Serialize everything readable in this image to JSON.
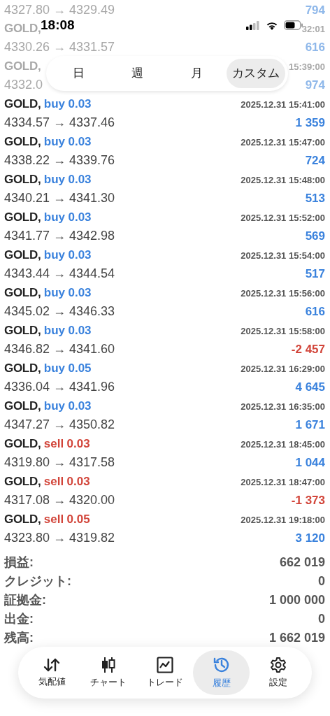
{
  "status_bar": {
    "time": "18:08"
  },
  "period_tabs": [
    {
      "label": "日",
      "selected": false
    },
    {
      "label": "週",
      "selected": false
    },
    {
      "label": "月",
      "selected": false
    },
    {
      "label": "カスタム",
      "selected": true
    }
  ],
  "partial_rows": [
    {
      "prices": "4327.80 → 4329.49",
      "amount": "794"
    },
    {
      "symbol": "GOLD,",
      "time": "32:01",
      "prices": "4330.26 → 4331.57",
      "amount": "616"
    },
    {
      "symbol": "GOLD,",
      "time": "15:39:00",
      "prices": "4332.0",
      "amount": "974"
    }
  ],
  "trades": [
    {
      "symbol": "GOLD,",
      "side": "buy",
      "volume": "0.03",
      "time": "2025.12.31 15:41:00",
      "prices": "4334.57 → 4337.46",
      "profit": "1 359"
    },
    {
      "symbol": "GOLD,",
      "side": "buy",
      "volume": "0.03",
      "time": "2025.12.31 15:47:00",
      "prices": "4338.22 → 4339.76",
      "profit": "724"
    },
    {
      "symbol": "GOLD,",
      "side": "buy",
      "volume": "0.03",
      "time": "2025.12.31 15:48:00",
      "prices": "4340.21 → 4341.30",
      "profit": "513"
    },
    {
      "symbol": "GOLD,",
      "side": "buy",
      "volume": "0.03",
      "time": "2025.12.31 15:52:00",
      "prices": "4341.77 → 4342.98",
      "profit": "569"
    },
    {
      "symbol": "GOLD,",
      "side": "buy",
      "volume": "0.03",
      "time": "2025.12.31 15:54:00",
      "prices": "4343.44 → 4344.54",
      "profit": "517"
    },
    {
      "symbol": "GOLD,",
      "side": "buy",
      "volume": "0.03",
      "time": "2025.12.31 15:56:00",
      "prices": "4345.02 → 4346.33",
      "profit": "616"
    },
    {
      "symbol": "GOLD,",
      "side": "buy",
      "volume": "0.03",
      "time": "2025.12.31 15:58:00",
      "prices": "4346.82 → 4341.60",
      "profit": "-2 457"
    },
    {
      "symbol": "GOLD,",
      "side": "buy",
      "volume": "0.05",
      "time": "2025.12.31 16:29:00",
      "prices": "4336.04 → 4341.96",
      "profit": "4 645"
    },
    {
      "symbol": "GOLD,",
      "side": "buy",
      "volume": "0.03",
      "time": "2025.12.31 16:35:00",
      "prices": "4347.27 → 4350.82",
      "profit": "1 671"
    },
    {
      "symbol": "GOLD,",
      "side": "sell",
      "volume": "0.03",
      "time": "2025.12.31 18:45:00",
      "prices": "4319.80 → 4317.58",
      "profit": "1 044"
    },
    {
      "symbol": "GOLD,",
      "side": "sell",
      "volume": "0.03",
      "time": "2025.12.31 18:47:00",
      "prices": "4317.08 → 4320.00",
      "profit": "-1 373"
    },
    {
      "symbol": "GOLD,",
      "side": "sell",
      "volume": "0.05",
      "time": "2025.12.31 19:18:00",
      "prices": "4323.80 → 4319.82",
      "profit": "3 120"
    }
  ],
  "summary": [
    {
      "label": "損益:",
      "value": "662 019"
    },
    {
      "label": "クレジット:",
      "value": "0"
    },
    {
      "label": "証拠金:",
      "value": "1 000 000"
    },
    {
      "label": "出金:",
      "value": "0"
    },
    {
      "label": "残高:",
      "value": "1 662 019"
    }
  ],
  "nav": [
    {
      "kind": "quotes",
      "label": "気配値",
      "selected": false
    },
    {
      "kind": "chart",
      "label": "チャート",
      "selected": false
    },
    {
      "kind": "trade",
      "label": "トレード",
      "selected": false
    },
    {
      "kind": "history",
      "label": "履歴",
      "selected": true
    },
    {
      "kind": "settings",
      "label": "設定",
      "selected": false
    }
  ]
}
